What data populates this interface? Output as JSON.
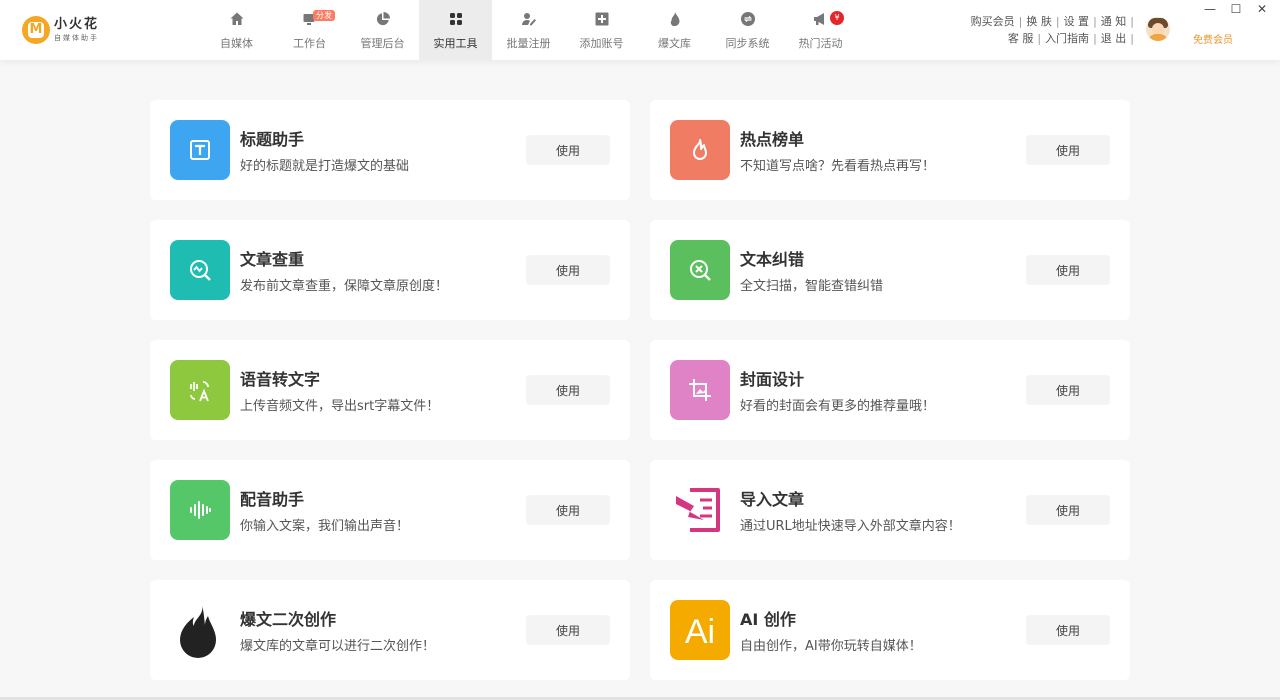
{
  "app": {
    "name": "小火花",
    "subtitle": "自媒体助手",
    "logo_letter": "M"
  },
  "nav": [
    {
      "label": "自媒体",
      "icon": "home-icon"
    },
    {
      "label": "工作台",
      "icon": "workbench-icon",
      "badge": "分发"
    },
    {
      "label": "管理后台",
      "icon": "pie-chart-icon"
    },
    {
      "label": "实用工具",
      "icon": "grid-icon",
      "active": true
    },
    {
      "label": "批量注册",
      "icon": "user-edit-icon"
    },
    {
      "label": "添加账号",
      "icon": "plus-box-icon"
    },
    {
      "label": "爆文库",
      "icon": "flame-icon"
    },
    {
      "label": "同步系统",
      "icon": "sync-icon"
    },
    {
      "label": "热门活动",
      "icon": "megaphone-icon",
      "badge": "¥"
    }
  ],
  "header_links": {
    "row1": [
      "购买会员",
      "换 肤",
      "设 置",
      "通 知"
    ],
    "row2": [
      "客 服",
      "入门指南",
      "退 出"
    ],
    "separator": "|"
  },
  "user": {
    "vip_label": "免费会员"
  },
  "window_controls": {
    "minimize": "—",
    "maximize": "☐",
    "close": "✕"
  },
  "tools": [
    {
      "title": "标题助手",
      "desc": "好的标题就是打造爆文的基础",
      "button": "使用",
      "icon": "title-t-icon",
      "color": "#3ea6f1"
    },
    {
      "title": "热点榜单",
      "desc": "不知道写点啥？先看看热点再写！",
      "button": "使用",
      "icon": "fire-icon",
      "color": "#f17c64"
    },
    {
      "title": "文章查重",
      "desc": "发布前文章查重，保障文章原创度！",
      "button": "使用",
      "icon": "search-wave-icon",
      "color": "#1fbcb1"
    },
    {
      "title": "文本纠错",
      "desc": "全文扫描，智能查错纠错",
      "button": "使用",
      "icon": "search-x-icon",
      "color": "#5cbf5e"
    },
    {
      "title": "语音转文字",
      "desc": "上传音频文件，导出srt字幕文件！",
      "button": "使用",
      "icon": "voice-to-text-icon",
      "color": "#8dc83f"
    },
    {
      "title": "封面设计",
      "desc": "好看的封面会有更多的推荐量哦！",
      "button": "使用",
      "icon": "crop-image-icon",
      "color": "#e082c6"
    },
    {
      "title": "配音助手",
      "desc": "你输入文案，我们输出声音！",
      "button": "使用",
      "icon": "sound-wave-icon",
      "color": "#55c768"
    },
    {
      "title": "导入文章",
      "desc": "通过URL地址快速导入外部文章内容！",
      "button": "使用",
      "icon": "import-article-icon",
      "color": "#ffffff"
    },
    {
      "title": "爆文二次创作",
      "desc": "爆文库的文章可以进行二次创作！",
      "button": "使用",
      "icon": "black-flame-icon",
      "color": "#ffffff"
    },
    {
      "title": "AI 创作",
      "desc": "自由创作，AI带你玩转自媒体！",
      "button": "使用",
      "icon": "ai-icon",
      "color": "#f5aa00"
    }
  ]
}
